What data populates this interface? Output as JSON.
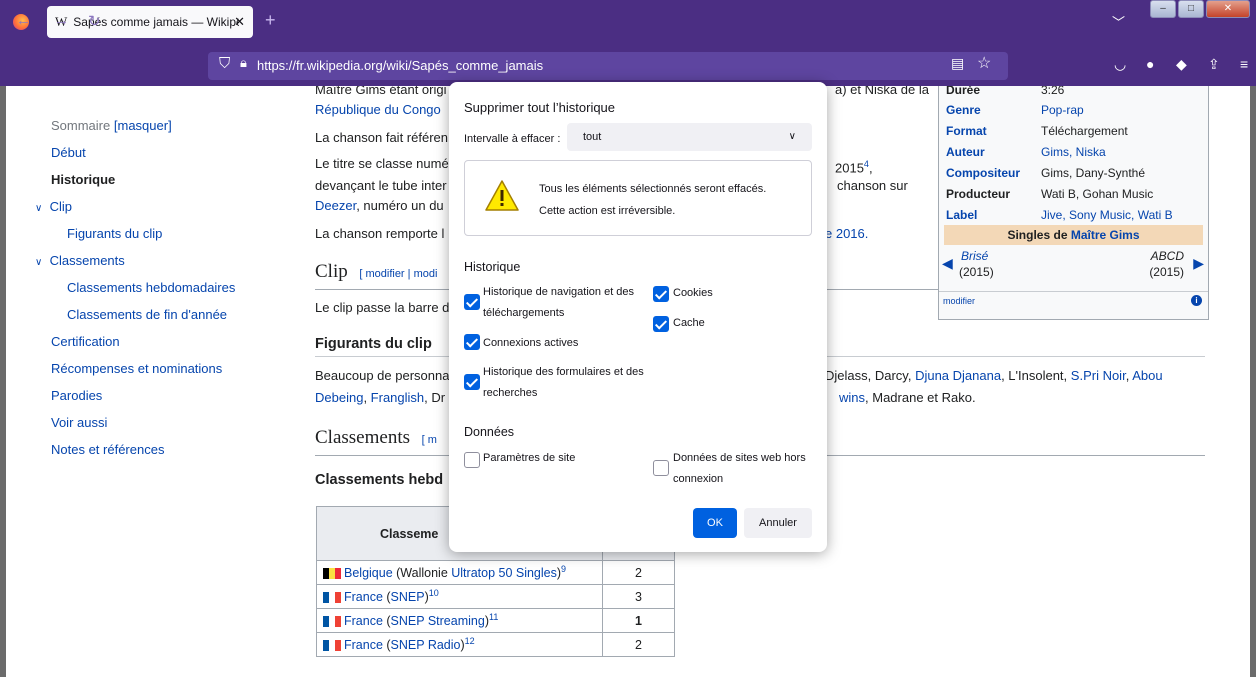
{
  "browser": {
    "tab_title": "Sapés comme jamais — Wikipé",
    "url": "https://fr.wikipedia.org/wiki/Sapés_comme_jamais"
  },
  "toc": {
    "header": "Sommaire",
    "toggle": "[masquer]",
    "items": [
      "Début",
      "Historique",
      "Clip",
      "Figurants du clip",
      "Classements",
      "Classements hebdomadaires",
      "Classements de fin d'année",
      "Certification",
      "Récompenses et nominations",
      "Parodies",
      "Voir aussi",
      "Notes et références"
    ]
  },
  "article": {
    "p1a": "Maître Gims étant origi",
    "p1a_end": "a) et Niska de la",
    "p1b": "République du Congo",
    "p2": "La chanson fait référen",
    "p3a": "Le titre se classe numé",
    "p3a_end": "2015",
    "p3a_sup": "4",
    "p3b": "devançant le tube inter",
    "p3b_end": "chanson sur",
    "p3c": "Deezer",
    "p3c_rest": ", numéro un du",
    "p4": "La chanson remporte l",
    "p4_end": "e 2016.",
    "clip_heading": "Clip",
    "clip_edit": "[ modifier | modi",
    "clip_text": "Le clip passe la barre d",
    "figurants_heading": "Figurants du clip",
    "fig_a": "Beaucoup de personna",
    "fig_a_end1": "Djelass, Darcy, ",
    "fig_a_end2": "Djuna Djanana",
    "fig_a_end3": ", L'Insolent, ",
    "fig_a_end4": "S.Pri Noir",
    "fig_a_end5": ", ",
    "fig_a_end6": "Abou",
    "fig_b1": "Debeing",
    "fig_b2": ", ",
    "fig_b3": "Franglish",
    "fig_b4": ", Dr",
    "fig_b_end1": "wins",
    "fig_b_end2": ", Madrane et Rako.",
    "classements_heading": "Classements",
    "classements_edit": "[ m",
    "classements_sub": "Classements hebd"
  },
  "infobox": {
    "rows": [
      {
        "k": "Durée",
        "v": "3:26"
      },
      {
        "k": "Genre",
        "v": "Pop-rap"
      },
      {
        "k": "Format",
        "v": "Téléchargement"
      },
      {
        "k": "Auteur",
        "v": "Gims, Niska"
      },
      {
        "k": "Compositeur",
        "v": "Gims, Dany-Synthé"
      },
      {
        "k": "Producteur",
        "v": "Wati B, Gohan Music"
      },
      {
        "k": "Label",
        "v": "Jive, Sony Music, Wati B"
      }
    ],
    "band_prefix": "Singles de ",
    "band_link": "Maître Gims",
    "prev_title": "Brisé",
    "prev_year": "(2015)",
    "next_title": "ABCD",
    "next_year": "(2015)",
    "modifier": "modifier"
  },
  "chart_table": {
    "header": "Classeme",
    "rows": [
      {
        "country": "Belgique",
        "paren_open": " (Wallonie ",
        "chart": "Ultratop 50 Singles",
        "paren_close": ")",
        "ref": "9",
        "pos": "2",
        "bold": false,
        "flag": "be"
      },
      {
        "country": "France",
        "paren_open": " (",
        "chart": "SNEP",
        "paren_close": ")",
        "ref": "10",
        "pos": "3",
        "bold": false,
        "flag": "fr"
      },
      {
        "country": "France",
        "paren_open": " (",
        "chart": "SNEP Streaming",
        "paren_close": ")",
        "ref": "11",
        "pos": "1",
        "bold": true,
        "flag": "fr"
      },
      {
        "country": "France",
        "paren_open": " (",
        "chart": "SNEP Radio",
        "paren_close": ")",
        "ref": "12",
        "pos": "2",
        "bold": false,
        "flag": "fr"
      }
    ]
  },
  "dialog": {
    "title": "Supprimer tout l’historique",
    "range_label": "Intervalle à effacer :",
    "range_value": "tout",
    "warning_1": "Tous les éléments sélectionnés seront effacés.",
    "warning_2": "Cette action est irréversible.",
    "history_heading": "Historique",
    "data_heading": "Données",
    "checkboxes": [
      {
        "label1": "Historique de navigation et des",
        "label2": "téléchargements",
        "checked": true
      },
      {
        "label1": "Cookies",
        "label2": "",
        "checked": true
      },
      {
        "label1": "Cache",
        "label2": "",
        "checked": true
      },
      {
        "label1": "Connexions actives",
        "label2": "",
        "checked": true
      },
      {
        "label1": "Historique des formulaires et des",
        "label2": "recherches",
        "checked": true
      },
      {
        "label1": "Paramètres de site",
        "label2": "",
        "checked": false
      },
      {
        "label1": "Données de sites web hors",
        "label2": "connexion",
        "checked": false
      }
    ],
    "ok_label": "OK",
    "cancel_label": "Annuler"
  },
  "colors": {
    "chrome": "#4b2e83",
    "link": "#0645ad",
    "accent": "#0061e0"
  }
}
